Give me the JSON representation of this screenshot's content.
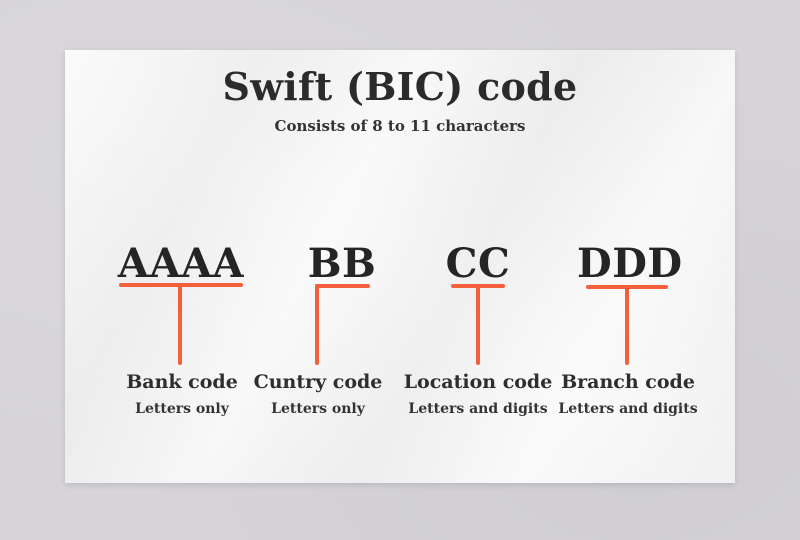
{
  "title": "Swift (BIC) code",
  "subtitle": "Consists of 8 to 11 characters",
  "accent_color": "#f4603c",
  "segments": [
    {
      "code": "AAAA",
      "label": "Bank code",
      "description": "Letters only"
    },
    {
      "code": "BB",
      "label": "Cuntry code",
      "description": "Letters only"
    },
    {
      "code": "CC",
      "label": "Location code",
      "description": "Letters and digits"
    },
    {
      "code": "DDD",
      "label": "Branch code",
      "description": "Letters and digits"
    }
  ]
}
